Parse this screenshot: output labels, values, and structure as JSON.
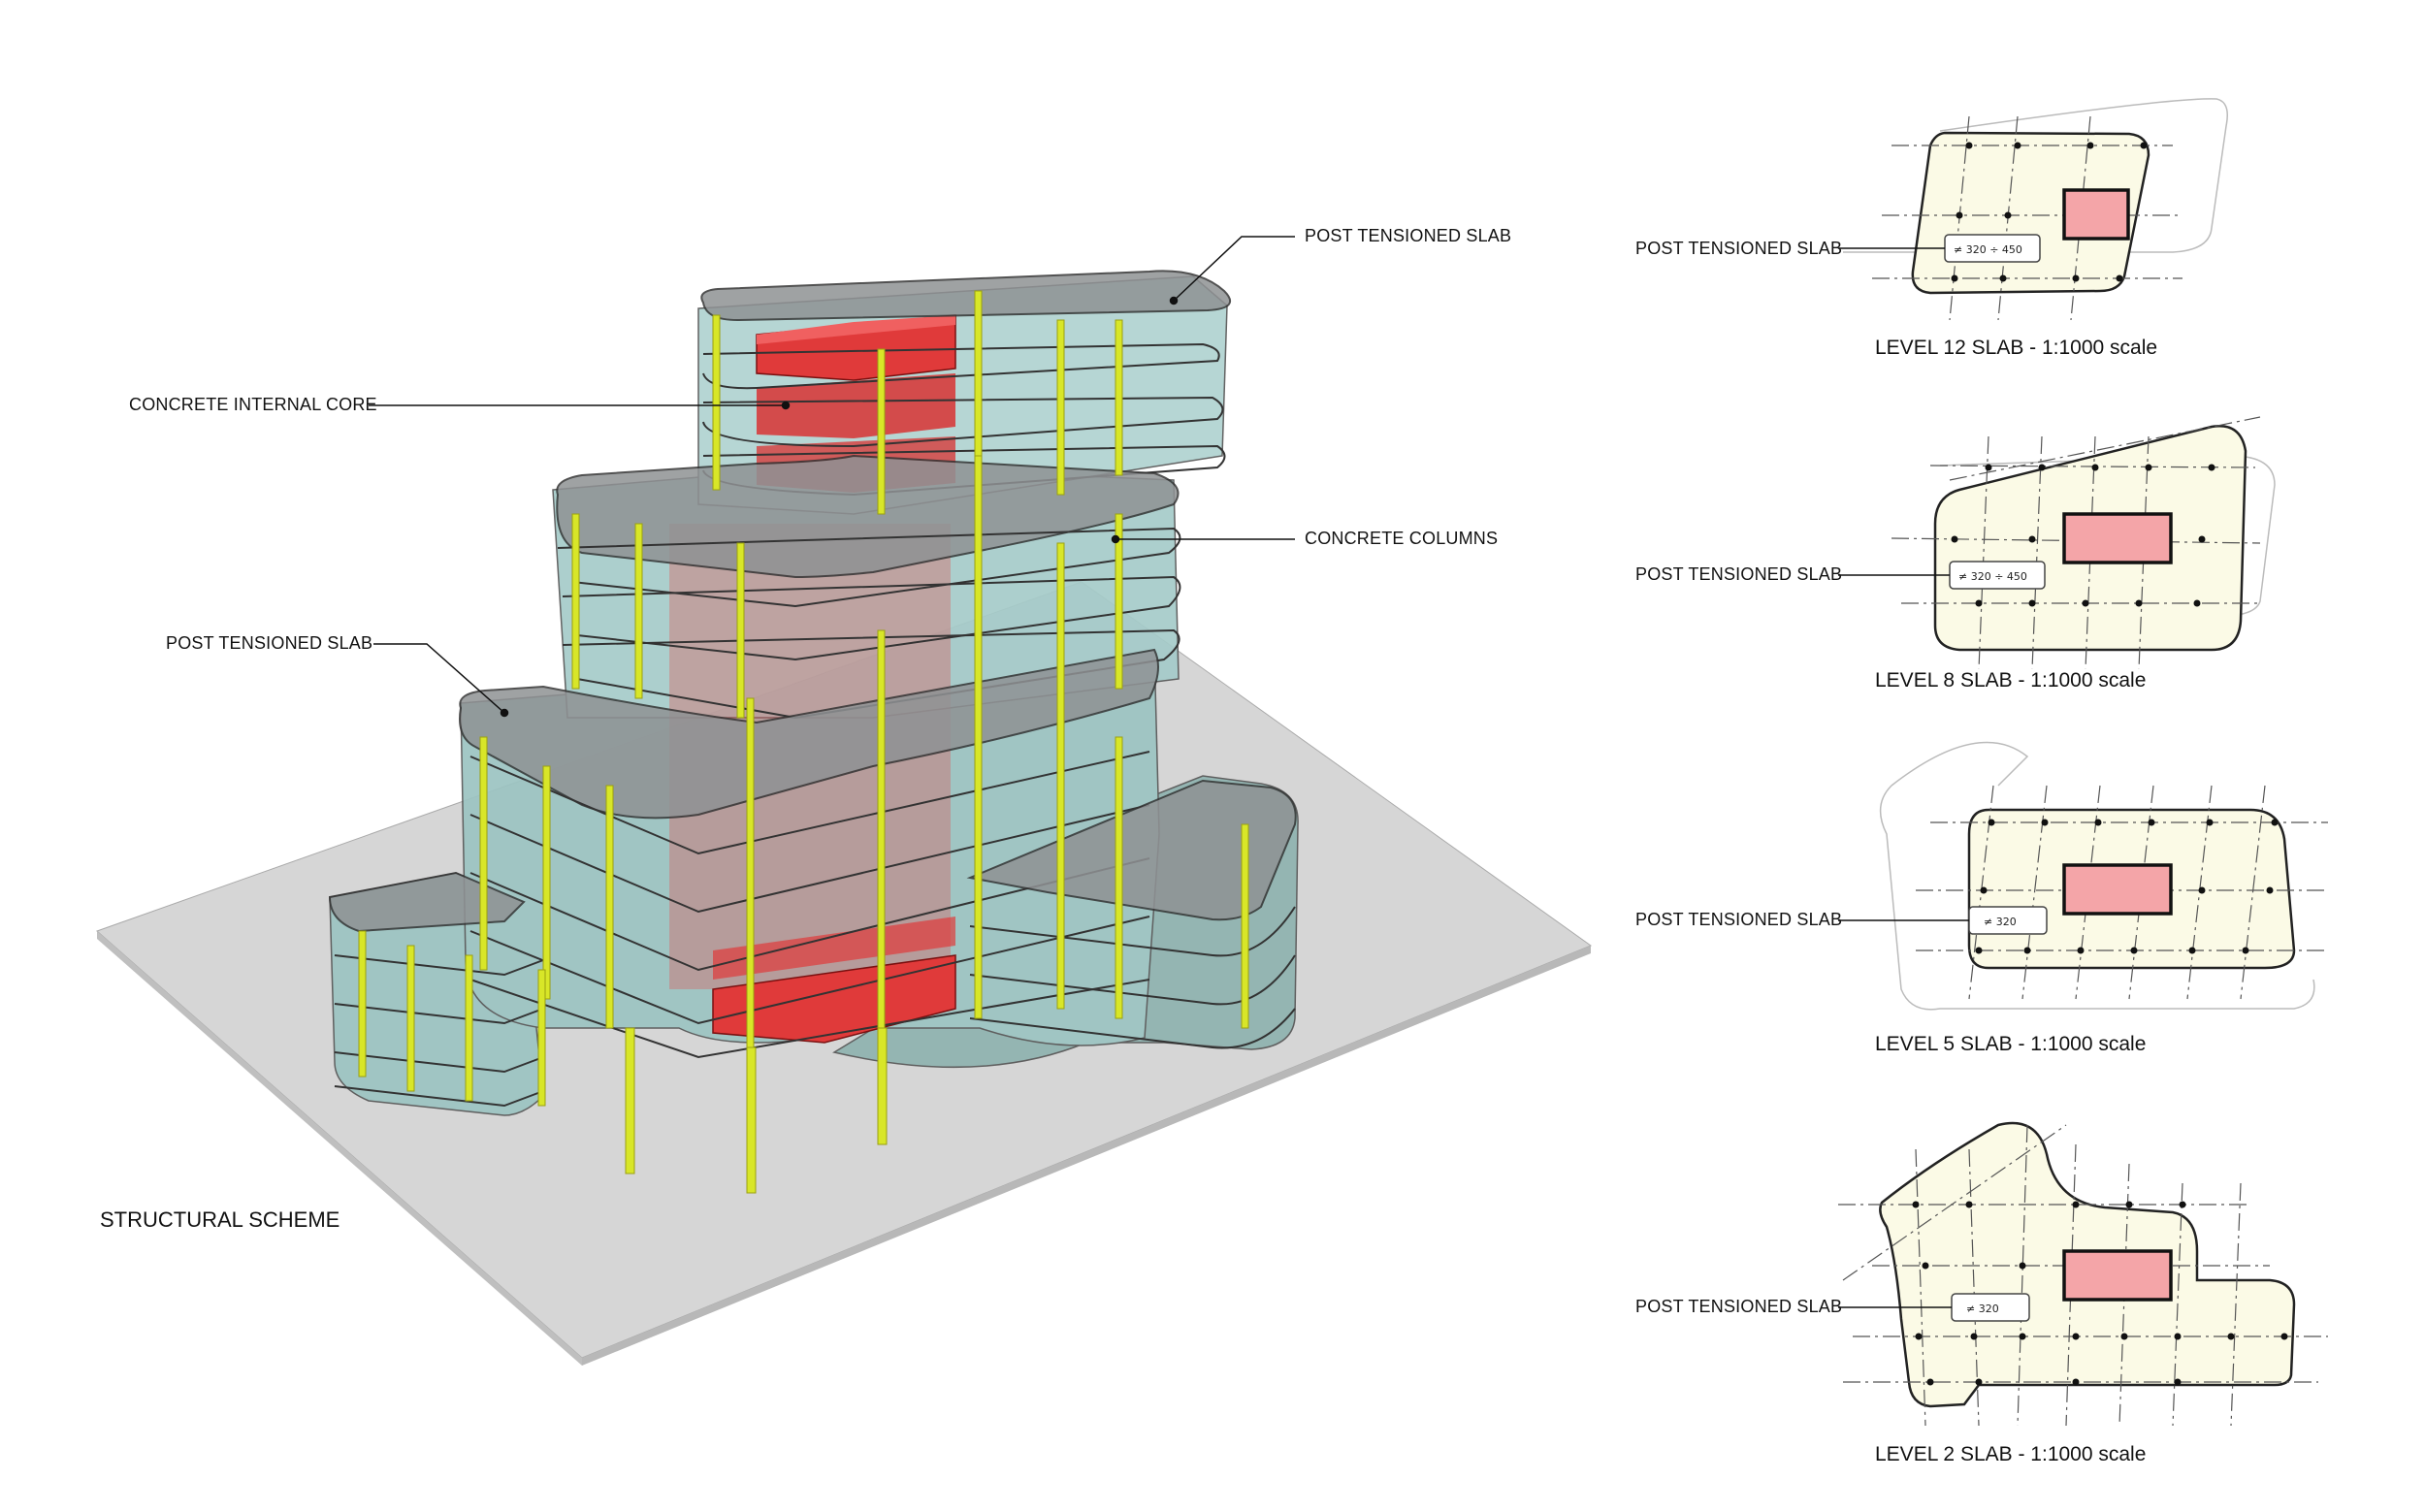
{
  "isometric": {
    "title": "STRUCTURAL SCHEME",
    "callouts": {
      "slab_top": "POST TENSIONED SLAB",
      "core": "CONCRETE INTERNAL CORE",
      "columns": "CONCRETE COLUMNS",
      "slab_mid": "POST TENSIONED SLAB"
    }
  },
  "plans": [
    {
      "callout": "POST TENSIONED SLAB",
      "thickness": "≠ 320 ÷ 450",
      "caption": "LEVEL 12 SLAB - 1:1000 scale"
    },
    {
      "callout": "POST TENSIONED SLAB",
      "thickness": "≠ 320 ÷ 450",
      "caption": "LEVEL 8 SLAB - 1:1000 scale"
    },
    {
      "callout": "POST TENSIONED SLAB",
      "thickness": "≠ 320",
      "caption": "LEVEL 5 SLAB - 1:1000 scale"
    },
    {
      "callout": "POST TENSIONED SLAB",
      "thickness": "≠ 320",
      "caption": "LEVEL 2 SLAB - 1:1000 scale"
    }
  ],
  "colors": {
    "ground": "#d6d6d6",
    "glass": "#9cc4c2",
    "slab_top": "#8f9294",
    "core": "#e03a3a",
    "column": "#d8e628",
    "plan_fill": "#fbfae6",
    "plan_core": "#f4a5a8"
  }
}
